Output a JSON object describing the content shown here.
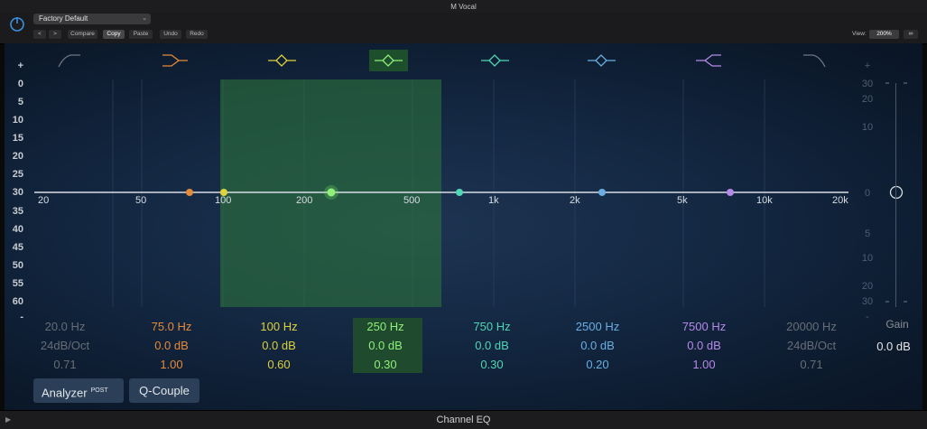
{
  "window": {
    "title": "M Vocal"
  },
  "header": {
    "preset": "Factory Default",
    "prev": "<",
    "next": ">",
    "compare": "Compare",
    "copy": "Copy",
    "paste": "Paste",
    "undo": "Undo",
    "redo": "Redo",
    "view_label": "View:",
    "view_value": "200%"
  },
  "graph": {
    "db_left_top": "+",
    "db_left_bottom": "-",
    "db_left": [
      "0",
      "5",
      "10",
      "15",
      "20",
      "25",
      "30",
      "35",
      "40",
      "45",
      "50",
      "55",
      "60"
    ],
    "db_right_top": "+",
    "db_right_bottom": "-",
    "db_right": [
      "30",
      "20",
      "10",
      "0",
      "5",
      "10",
      "20",
      "30"
    ],
    "freq_labels": [
      "20",
      "50",
      "100",
      "200",
      "500",
      "1k",
      "2k",
      "5k",
      "10k",
      "20k"
    ]
  },
  "bands": [
    {
      "freq": "20.0 Hz",
      "gain": "24dB/Oct",
      "q": "0.71",
      "color": "#6f7580",
      "shape": "low-cut-icon"
    },
    {
      "freq": "75.0 Hz",
      "gain": "0.0 dB",
      "q": "1.00",
      "color": "#e58a3a",
      "shape": "low-shelf-icon"
    },
    {
      "freq": "100 Hz",
      "gain": "0.0 dB",
      "q": "0.60",
      "color": "#e0d23c",
      "shape": "bell-icon"
    },
    {
      "freq": "250 Hz",
      "gain": "0.0 dB",
      "q": "0.30",
      "color": "#7ee86a",
      "shape": "bell-icon"
    },
    {
      "freq": "750 Hz",
      "gain": "0.0 dB",
      "q": "0.30",
      "color": "#4fd6b4",
      "shape": "bell-icon"
    },
    {
      "freq": "2500 Hz",
      "gain": "0.0 dB",
      "q": "0.20",
      "color": "#6aaee2",
      "shape": "bell-icon"
    },
    {
      "freq": "7500 Hz",
      "gain": "0.0 dB",
      "q": "1.00",
      "color": "#b48ae8",
      "shape": "high-shelf-icon"
    },
    {
      "freq": "20000 Hz",
      "gain": "24dB/Oct",
      "q": "0.71",
      "color": "#6f7580",
      "shape": "high-cut-icon"
    }
  ],
  "gain": {
    "label": "Gain",
    "value": "0.0 dB"
  },
  "buttons": {
    "analyzer": "Analyzer",
    "analyzer_badge": "POST",
    "qcouple": "Q-Couple"
  },
  "footer": {
    "title": "Channel EQ"
  }
}
